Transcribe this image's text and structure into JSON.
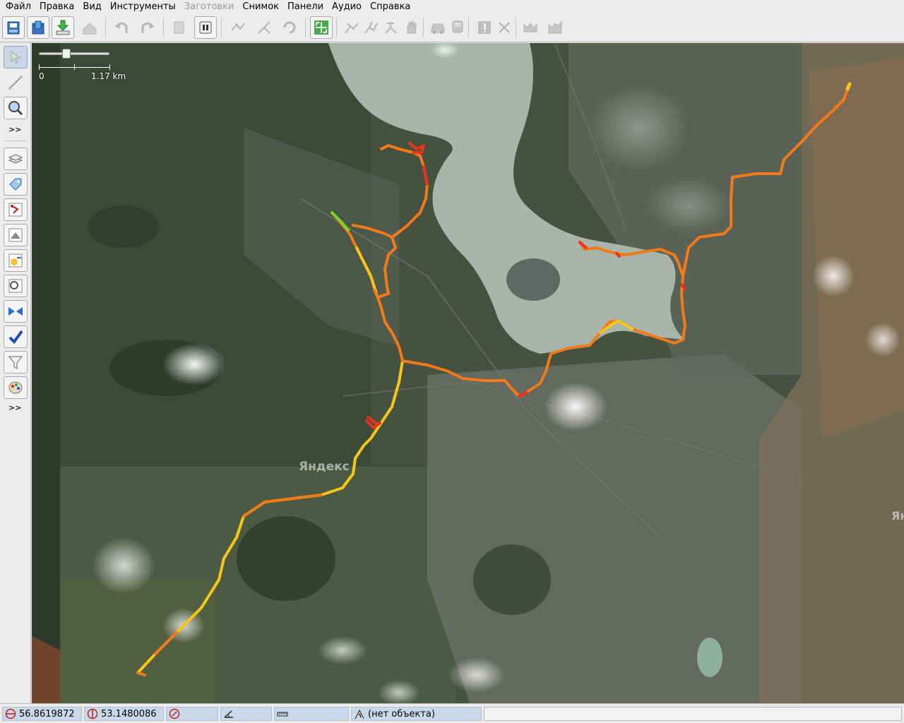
{
  "menubar": {
    "items": [
      {
        "label": "Файл",
        "enabled": true
      },
      {
        "label": "Правка",
        "enabled": true
      },
      {
        "label": "Вид",
        "enabled": true
      },
      {
        "label": "Инструменты",
        "enabled": true
      },
      {
        "label": "Заготовки",
        "enabled": false
      },
      {
        "label": "Снимок",
        "enabled": true
      },
      {
        "label": "Панели",
        "enabled": true
      },
      {
        "label": "Аудио",
        "enabled": true
      },
      {
        "label": "Справка",
        "enabled": true
      }
    ]
  },
  "toolbar": {
    "buttons": [
      {
        "name": "open-file-icon",
        "enabled": true
      },
      {
        "name": "open-location-icon",
        "enabled": true
      },
      {
        "name": "download-icon",
        "enabled": true
      },
      {
        "name": "upload-icon",
        "enabled": false
      },
      {
        "name": "undo-icon",
        "enabled": false
      },
      {
        "name": "redo-icon",
        "enabled": false
      },
      {
        "name": "copy-icon",
        "enabled": false
      },
      {
        "name": "preferences-icon",
        "enabled": true
      },
      {
        "name": "split-way-icon",
        "enabled": false
      },
      {
        "name": "combine-way-icon",
        "enabled": false
      },
      {
        "name": "reverse-way-icon",
        "enabled": false
      },
      {
        "name": "zoom-to-fit-icon",
        "enabled": true
      },
      {
        "name": "walk-icon",
        "enabled": false
      },
      {
        "name": "run-icon",
        "enabled": false
      },
      {
        "name": "bike-icon",
        "enabled": false
      },
      {
        "name": "hand-icon",
        "enabled": false
      },
      {
        "name": "car-icon",
        "enabled": false
      },
      {
        "name": "bus-icon",
        "enabled": false
      },
      {
        "name": "info-icon",
        "enabled": false
      },
      {
        "name": "delete-icon",
        "enabled": false
      },
      {
        "name": "crown-icon",
        "enabled": false
      },
      {
        "name": "profile-icon",
        "enabled": false
      }
    ]
  },
  "lefttoolbar": {
    "more_label_top": ">>",
    "more_label_bottom": ">>",
    "tools": [
      {
        "name": "select-tool-icon",
        "active": true
      },
      {
        "name": "draw-line-icon",
        "active": false
      },
      {
        "name": "zoom-tool-icon",
        "active": false
      }
    ],
    "panels": [
      {
        "name": "layers-icon"
      },
      {
        "name": "tags-icon"
      },
      {
        "name": "relations-icon"
      },
      {
        "name": "selection-icon"
      },
      {
        "name": "history-icon"
      },
      {
        "name": "conflicts-icon"
      },
      {
        "name": "merge-icon"
      },
      {
        "name": "validation-icon"
      },
      {
        "name": "filter-icon"
      },
      {
        "name": "map-paint-icon"
      }
    ]
  },
  "map": {
    "scale_zero": "0",
    "scale_label": "1.17 km",
    "watermark": "Яндекс",
    "watermark_right": "Янс",
    "zoom_level": 0.38,
    "colors": {
      "track_red": "#e8341c",
      "track_orange": "#f27a18",
      "track_yellow": "#f7c718",
      "track_green": "#7ad428",
      "lake": "#a9b4ab"
    }
  },
  "statusbar": {
    "latitude": "56.8619872",
    "longitude": "53.1480086",
    "heading": "",
    "angle": "",
    "distance": "",
    "object": "(нет объекта)"
  }
}
